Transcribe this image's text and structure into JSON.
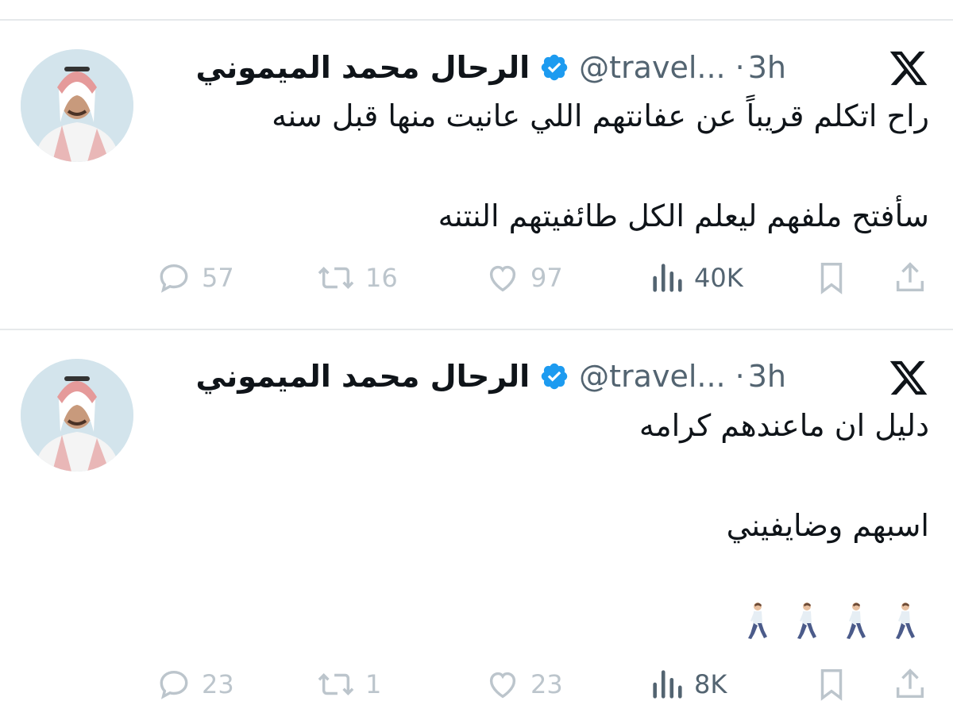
{
  "tweets": [
    {
      "display_name": "الرحال محمد الميموني",
      "handle": "@travel...",
      "separator": "·",
      "time": "3h",
      "lines": [
        "راح اتكلم قريباً عن عفانتهم اللي عانيت منها قبل سنه",
        "سأفتح ملفهم ليعلم الكل طائفيتهم النتنه"
      ],
      "emoji": [],
      "replies": "57",
      "retweets": "16",
      "likes": "97",
      "views": "40K"
    },
    {
      "display_name": "الرحال محمد الميموني",
      "handle": "@travel...",
      "separator": "·",
      "time": "3h",
      "lines": [
        "دليل ان ماعندهم كرامه",
        "اسبهم وضايفيني"
      ],
      "emoji": [
        "person-walking",
        "person-walking",
        "person-walking",
        "person-walking"
      ],
      "replies": "23",
      "retweets": "1",
      "likes": "23",
      "views": "8K"
    }
  ],
  "colors": {
    "text": "#0f1419",
    "muted": "#536471",
    "action_icon": "#bcc5cc",
    "verified_blue": "#1d9bf0",
    "divider": "#e6e9eb"
  },
  "icons": {
    "brand": "x-logo-icon",
    "verified": "verified-badge-icon",
    "reply": "reply-icon",
    "retweet": "retweet-icon",
    "like": "heart-icon",
    "views": "views-bar-chart-icon",
    "bookmark": "bookmark-icon",
    "share": "share-icon"
  }
}
